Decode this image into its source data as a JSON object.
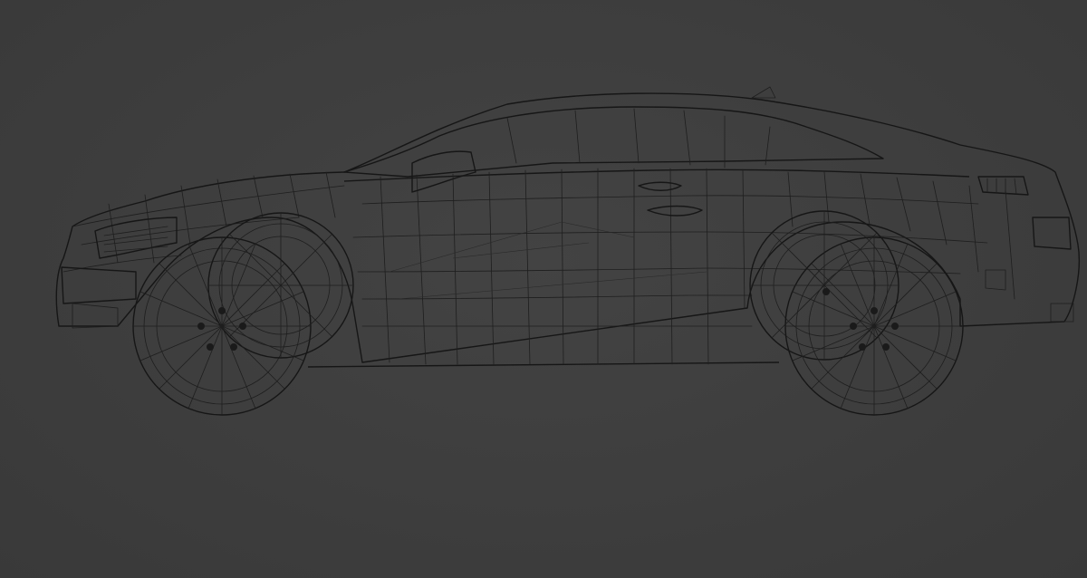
{
  "viewport": {
    "background": "#3f3f3f",
    "wire_color": "#1e1e1e",
    "subject": "car-wireframe-side-view"
  }
}
